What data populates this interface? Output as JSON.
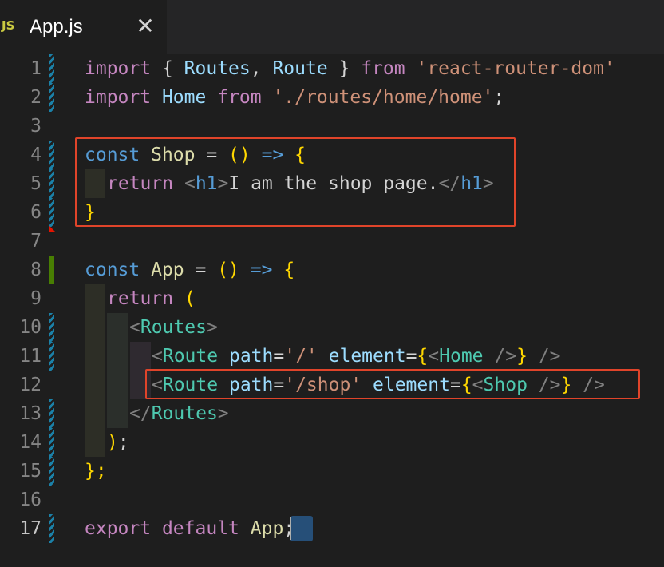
{
  "tab": {
    "icon": "JS",
    "title": "App.js",
    "close_icon": "close-icon",
    "close_glyph": "✕"
  },
  "editor": {
    "line_numbers": [
      "1",
      "2",
      "3",
      "4",
      "5",
      "6",
      "7",
      "8",
      "9",
      "10",
      "11",
      "12",
      "13",
      "14",
      "15",
      "16",
      "17"
    ],
    "active_line": "17",
    "colors": {
      "background": "#1e1e1e",
      "keyword": "#c586c0",
      "string": "#ce9178",
      "variable": "#9cdcfe",
      "function": "#dcdcaa",
      "storage": "#569cd6",
      "component": "#4ec9b0",
      "highlight_box": "#e0442a"
    },
    "lines": {
      "l1": {
        "a": "import",
        "b": " { ",
        "c": "Routes",
        "d": ", ",
        "e": "Route",
        "f": " } ",
        "g": "from",
        "h": " ",
        "i": "'react-router-dom'"
      },
      "l2": {
        "a": "import",
        "b": " ",
        "c": "Home",
        "d": " ",
        "e": "from",
        "f": " ",
        "g": "'./routes/home/home'",
        "h": ";"
      },
      "l4": {
        "a": "const",
        "b": " ",
        "c": "Shop",
        "d": " = ",
        "e": "()",
        "f": " ",
        "g": "=>",
        "h": " ",
        "i": "{"
      },
      "l5": {
        "a": "return",
        "b": " ",
        "c": "<",
        "d": "h1",
        "e": ">",
        "f": "I am the shop page.",
        "g": "</",
        "h": "h1",
        "i": ">"
      },
      "l6": {
        "a": "}"
      },
      "l8": {
        "a": "const",
        "b": " ",
        "c": "App",
        "d": " = ",
        "e": "()",
        "f": " ",
        "g": "=>",
        "h": " ",
        "i": "{"
      },
      "l9": {
        "a": "return",
        "b": " ",
        "c": "("
      },
      "l10": {
        "a": "<",
        "b": "Routes",
        "c": ">"
      },
      "l11": {
        "a": "<",
        "b": "Route",
        "c": " ",
        "d": "path",
        "e": "=",
        "f": "'/'",
        "g": " ",
        "h": "element",
        "i": "=",
        "j": "{",
        "k": "<",
        "l": "Home",
        "m": " />",
        "n": "}",
        "o": " />"
      },
      "l12": {
        "a": "<",
        "b": "Route",
        "c": " ",
        "d": "path",
        "e": "=",
        "f": "'/shop'",
        "g": " ",
        "h": "element",
        "i": "=",
        "j": "{",
        "k": "<",
        "l": "Shop",
        "m": " />",
        "n": "}",
        "o": " />"
      },
      "l13": {
        "a": "</",
        "b": "Routes",
        "c": ">"
      },
      "l14": {
        "a": ")",
        "b": ";"
      },
      "l15": {
        "a": "};"
      },
      "l17": {
        "a": "export",
        "b": " ",
        "c": "default",
        "d": " ",
        "e": "App",
        "f": ";"
      }
    }
  }
}
